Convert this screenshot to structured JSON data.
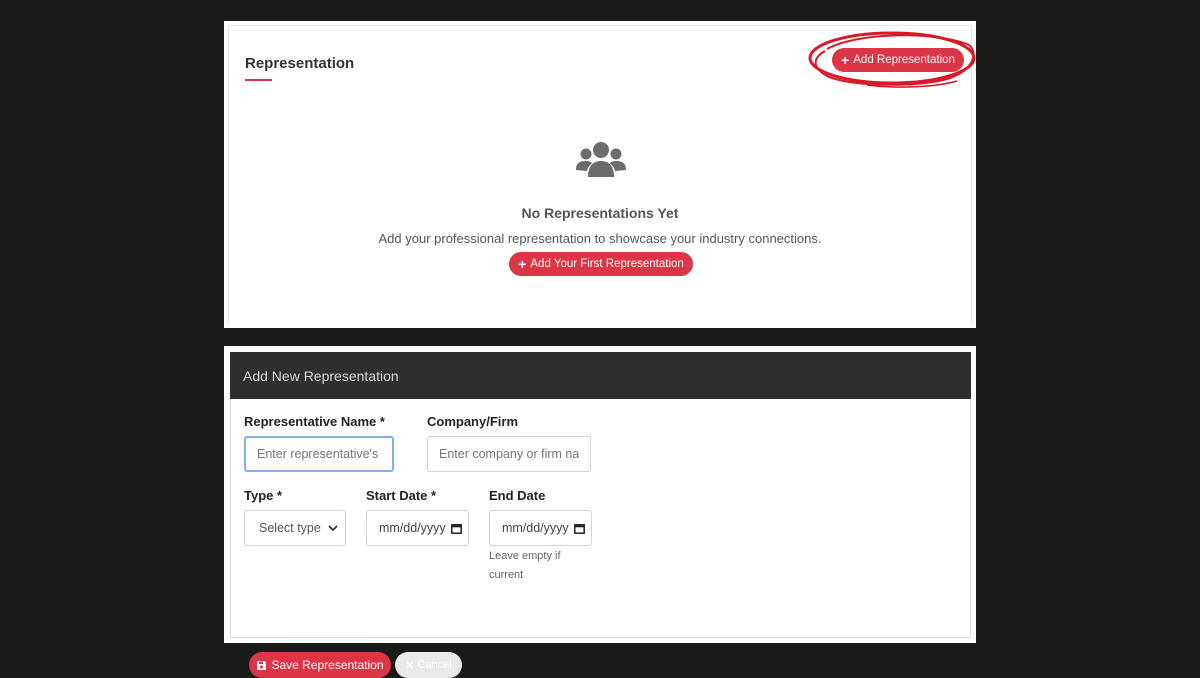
{
  "representation": {
    "title": "Representation",
    "add_button_label": "Add Representation",
    "empty_state": {
      "icon": "users-icon",
      "heading": "No Representations Yet",
      "text": "Add your professional representation to showcase your industry connections.",
      "button_label": "Add Your First Representation"
    }
  },
  "form": {
    "header": "Add New Representation",
    "name_label": "Representative Name *",
    "name_placeholder": "Enter representative's full name",
    "company_label": "Company/Firm",
    "company_placeholder": "Enter company or firm name",
    "type_label": "Type *",
    "type_value": "Select type",
    "start_label": "Start Date *",
    "start_value": "mm/dd/yyyy",
    "end_label": "End Date",
    "end_value": "mm/dd/yyyy",
    "end_help": "Leave empty if current",
    "save_label": "Save Representation",
    "cancel_label": "Cancel"
  },
  "colors": {
    "accent": "#dc3545",
    "annotation": "#d91828",
    "header_bg": "#2f2f2f",
    "page_bg": "#1a1a18"
  }
}
